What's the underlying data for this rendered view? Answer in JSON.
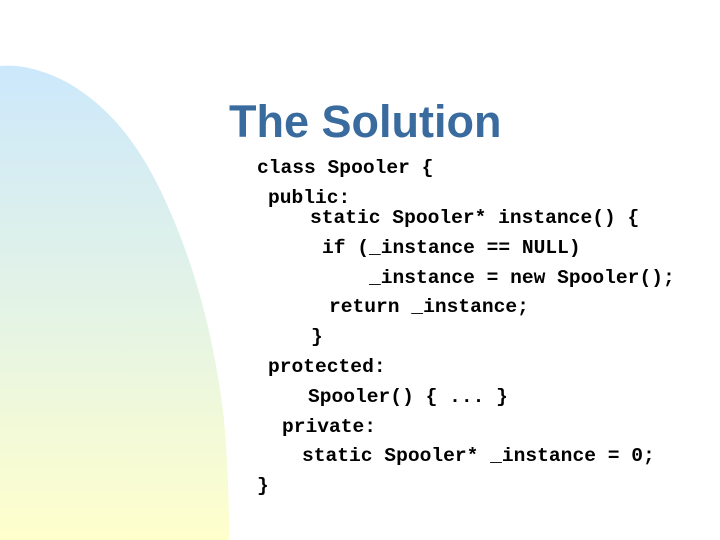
{
  "slide": {
    "title": "The Solution",
    "title_color": "#3a6b9f",
    "background_shape": {
      "gradient_top_color": "#cce8fb",
      "gradient_bottom_color": "#ffffcc"
    },
    "code_lines": [
      "class Spooler {",
      "public:",
      "static Spooler* instance() {",
      "if (_instance == NULL)",
      "_instance = new Spooler();",
      "return _instance;",
      "}",
      "protected:",
      "Spooler() { ... }",
      "private:",
      "static Spooler* _instance = 0;",
      "}"
    ]
  }
}
